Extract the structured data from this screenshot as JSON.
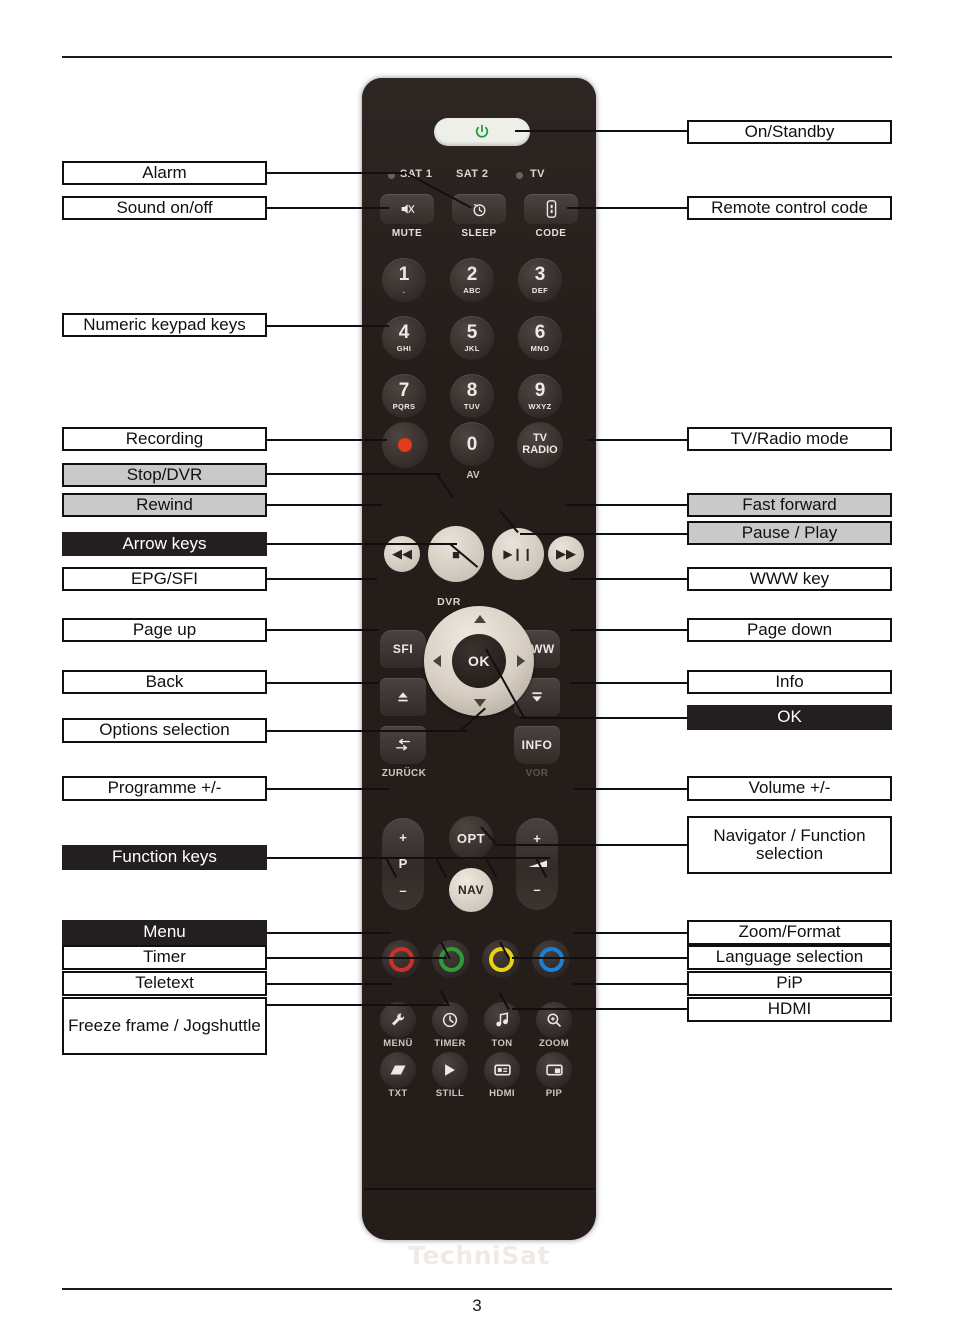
{
  "page": {
    "number": "3"
  },
  "remote": {
    "brand": "TechniSat",
    "modes": [
      {
        "name": "SAT 1",
        "label": "SAT 1"
      },
      {
        "name": "SAT 2",
        "label": "SAT 2"
      },
      {
        "name": "TV",
        "label": "TV"
      }
    ],
    "power": {
      "icon": "power-icon"
    },
    "pill_keys": [
      {
        "caption": "MUTE",
        "icon": "mute-icon"
      },
      {
        "caption": "SLEEP",
        "icon": "sleep-clock-icon"
      },
      {
        "caption": "CODE",
        "icon": "code-icon"
      }
    ],
    "numeric_keys": [
      {
        "digit": "1",
        "sub": "."
      },
      {
        "digit": "2",
        "sub": "ABC"
      },
      {
        "digit": "3",
        "sub": "DEF"
      },
      {
        "digit": "4",
        "sub": "GHI"
      },
      {
        "digit": "5",
        "sub": "JKL"
      },
      {
        "digit": "6",
        "sub": "MNO"
      },
      {
        "digit": "7",
        "sub": "PQRS"
      },
      {
        "digit": "8",
        "sub": "TUV"
      },
      {
        "digit": "9",
        "sub": "WXYZ"
      }
    ],
    "zero_key": {
      "digit": "0",
      "caption": "AV"
    },
    "tv_radio_key": {
      "line1": "TV",
      "line2": "RADIO"
    },
    "transport": {
      "dvr_caption": "DVR",
      "rewind": "◀◀",
      "stop": "■",
      "play_pause": "▶❙❙",
      "forward": "▶▶"
    },
    "nav_side_keys": {
      "sfi": "SFI",
      "www": "WWW",
      "info": "INFO",
      "back_caption": "ZURÜCK",
      "forward_caption": "VOR"
    },
    "dpad": {
      "ok": "OK"
    },
    "rockers": {
      "programme": {
        "plus": "+",
        "letter": "P",
        "minus": "–"
      },
      "volume": {
        "plus": "+",
        "minus": "–"
      }
    },
    "opt_key": "OPT",
    "nav_key": "NAV",
    "colour_keys": [
      {
        "name": "red",
        "color": "#c9312a"
      },
      {
        "name": "green",
        "color": "#2f9c3c"
      },
      {
        "name": "yellow",
        "color": "#e8d21a"
      },
      {
        "name": "blue",
        "color": "#1f7fd4"
      }
    ],
    "icon_keys": [
      {
        "caption": "MENÜ",
        "icon": "wrench-icon",
        "glyph": "🔧"
      },
      {
        "caption": "TIMER",
        "icon": "clock-icon",
        "glyph": "◷"
      },
      {
        "caption": "TON",
        "icon": "music-note-icon",
        "glyph": "♪"
      },
      {
        "caption": "ZOOM",
        "icon": "magnifier-plus-icon",
        "glyph": "⊕"
      },
      {
        "caption": "TXT",
        "icon": "teletext-icon",
        "glyph": "▤"
      },
      {
        "caption": "STILL",
        "icon": "play-icon",
        "glyph": "▶"
      },
      {
        "caption": "HDMI",
        "icon": "hdmi-icon",
        "glyph": "▦"
      },
      {
        "caption": "PIP",
        "icon": "pip-icon",
        "glyph": "❐"
      }
    ]
  },
  "labels_left": [
    {
      "id": "alarm",
      "text": "Alarm",
      "style": "white"
    },
    {
      "id": "sound-on-off",
      "text": "Sound on/off",
      "style": "white"
    },
    {
      "id": "numeric-keypad-keys",
      "text": "Numeric keypad keys",
      "style": "white"
    },
    {
      "id": "recording",
      "text": "Recording",
      "style": "white"
    },
    {
      "id": "stop-dvr",
      "text": "Stop/DVR",
      "style": "gray"
    },
    {
      "id": "rewind",
      "text": "Rewind",
      "style": "gray"
    },
    {
      "id": "arrow-keys",
      "text": "Arrow keys",
      "style": "black"
    },
    {
      "id": "epg-sfi",
      "text": "EPG/SFI",
      "style": "white"
    },
    {
      "id": "page-up",
      "text": "Page up",
      "style": "white"
    },
    {
      "id": "back",
      "text": "Back",
      "style": "white"
    },
    {
      "id": "options-selection",
      "text": "Options selection",
      "style": "white"
    },
    {
      "id": "programme-plus-minus",
      "text": "Programme +/-",
      "style": "white"
    },
    {
      "id": "function-keys",
      "text": "Function keys",
      "style": "black"
    },
    {
      "id": "menu",
      "text": "Menu",
      "style": "black"
    },
    {
      "id": "timer",
      "text": "Timer",
      "style": "white"
    },
    {
      "id": "teletext",
      "text": "Teletext",
      "style": "white"
    },
    {
      "id": "freeze-frame-jogshuttle",
      "text": "Freeze frame / Jogshuttle",
      "style": "white"
    }
  ],
  "labels_right": [
    {
      "id": "on-standby",
      "text": "On/Standby",
      "style": "white"
    },
    {
      "id": "remote-control-code",
      "text": "Remote control code",
      "style": "white"
    },
    {
      "id": "tv-radio-mode",
      "text": "TV/Radio mode",
      "style": "white"
    },
    {
      "id": "fast-forward",
      "text": "Fast forward",
      "style": "gray"
    },
    {
      "id": "pause-play",
      "text": "Pause / Play",
      "style": "gray"
    },
    {
      "id": "www-key",
      "text": "WWW key",
      "style": "white"
    },
    {
      "id": "page-down",
      "text": "Page down",
      "style": "white"
    },
    {
      "id": "info",
      "text": "Info",
      "style": "white"
    },
    {
      "id": "ok",
      "text": "OK",
      "style": "black"
    },
    {
      "id": "volume-plus-minus",
      "text": "Volume +/-",
      "style": "white"
    },
    {
      "id": "navigator-function-selection",
      "text": "Navigator / Function selection",
      "style": "white"
    },
    {
      "id": "zoom-format",
      "text": "Zoom/Format",
      "style": "white"
    },
    {
      "id": "language-selection",
      "text": "Language selection",
      "style": "white"
    },
    {
      "id": "pip",
      "text": "PiP",
      "style": "white"
    },
    {
      "id": "hdmi",
      "text": "HDMI",
      "style": "white"
    }
  ]
}
